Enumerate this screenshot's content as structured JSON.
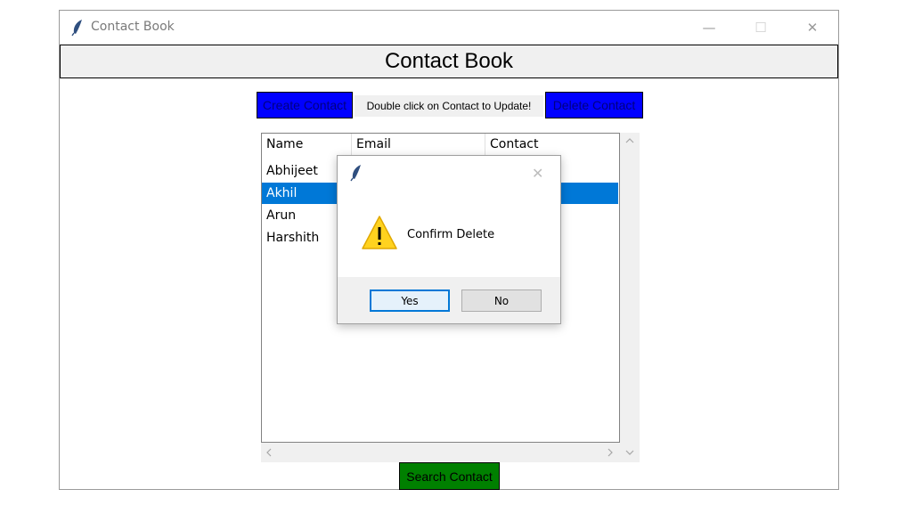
{
  "window": {
    "title": "Contact Book",
    "minimize_glyph": "—",
    "maximize_glyph": "☐",
    "close_glyph": "✕"
  },
  "header": {
    "title": "Contact Book"
  },
  "toolbar": {
    "create_label": "Create Contact",
    "hint_text": "Double click on Contact to Update!",
    "delete_label": "Delete Contact"
  },
  "table": {
    "columns": [
      "Name",
      "Email",
      "Contact"
    ],
    "rows": [
      "Abhijeet",
      "Akhil",
      "Arun",
      "Harshith"
    ],
    "selected_index": 1
  },
  "search": {
    "label": "Search Contact"
  },
  "dialog": {
    "close_glyph": "✕",
    "message": "Confirm Delete",
    "yes_label": "Yes",
    "no_label": "No"
  },
  "icons": {
    "app": "feather-icon",
    "warning": "warning-icon"
  },
  "colors": {
    "action_blue": "#0000ff",
    "search_green": "#008000",
    "selection": "#0078d7"
  }
}
